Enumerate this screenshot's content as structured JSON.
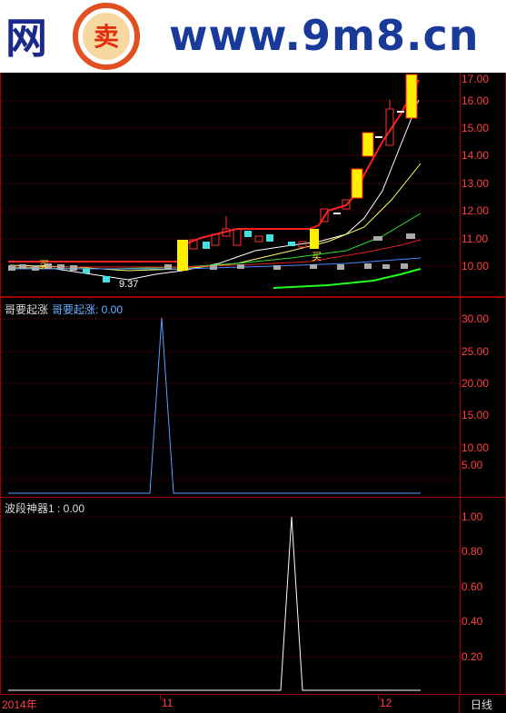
{
  "watermark": {
    "left_text": "网",
    "logo_text": "卖",
    "site_text": "www.9m8.cn"
  },
  "main_panel": {
    "y_ticks": [
      "17.00",
      "16.00",
      "15.00",
      "14.00",
      "13.00",
      "12.00",
      "11.00",
      "10.00"
    ],
    "annotations": {
      "buy1": "买",
      "low_label": "9.37",
      "buy2": "买"
    }
  },
  "panel2": {
    "title": "哥要起涨",
    "indicator_label": "哥要起涨: 0.00",
    "y_ticks": [
      "30.00",
      "25.00",
      "20.00",
      "15.00",
      "10.00",
      "5.00"
    ]
  },
  "panel3": {
    "indicator_label": "波段神器1 : 0.00",
    "y_ticks": [
      "1.00",
      "0.80",
      "0.60",
      "0.40",
      "0.20"
    ]
  },
  "x_axis": {
    "labels": [
      "2014年",
      "11",
      "12"
    ],
    "period": "日线"
  },
  "colors": {
    "frame": "#a00000",
    "axis_text": "#ff4040",
    "panel2_line": "#5aa0ff",
    "panel3_line": "#ffffff"
  }
}
